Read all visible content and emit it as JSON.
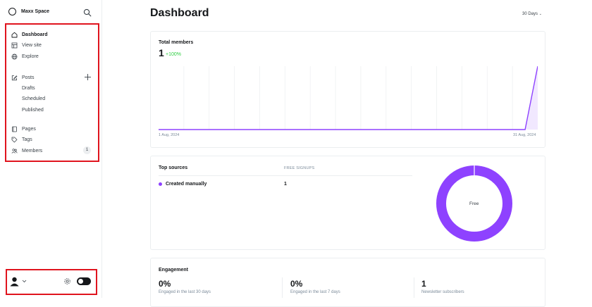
{
  "sidebar": {
    "brand": "Maxx Space",
    "nav_primary": [
      {
        "label": "Dashboard",
        "icon": "home-icon",
        "active": true
      },
      {
        "label": "View site",
        "icon": "layout-icon"
      },
      {
        "label": "Explore",
        "icon": "globe-icon"
      }
    ],
    "posts": {
      "label": "Posts",
      "icon": "pencil-square-icon",
      "sub": [
        "Drafts",
        "Scheduled",
        "Published"
      ]
    },
    "nav_secondary": [
      {
        "label": "Pages",
        "icon": "page-icon"
      },
      {
        "label": "Tags",
        "icon": "tag-icon"
      },
      {
        "label": "Members",
        "icon": "users-icon",
        "count": "1"
      }
    ]
  },
  "header": {
    "title": "Dashboard",
    "range": "30 Days"
  },
  "members_card": {
    "title": "Total members",
    "value": "1",
    "change": "+100%",
    "x_start": "1 Aug, 2024",
    "x_end": "31 Aug, 2024"
  },
  "chart_data": {
    "type": "line",
    "x": [
      "1 Aug, 2024",
      "31 Aug, 2024"
    ],
    "series": [
      {
        "values": [
          0,
          0,
          0,
          0,
          0,
          0,
          0,
          0,
          0,
          0,
          0,
          0,
          0,
          0,
          0,
          0,
          0,
          0,
          0,
          0,
          0,
          0,
          0,
          0,
          0,
          0,
          0,
          0,
          0,
          0,
          1
        ]
      }
    ],
    "color": "#8e42ff",
    "ylim": [
      0,
      1
    ],
    "grid": true
  },
  "sources_card": {
    "title": "Top sources",
    "col_header": "FREE SIGNUPS",
    "rows": [
      {
        "label": "Created manually",
        "value": "1"
      }
    ],
    "donut_label": "Free",
    "donut_color": "#8e42ff"
  },
  "engagement_card": {
    "title": "Engagement",
    "stats": [
      {
        "value": "0%",
        "caption": "Engaged in the last 30 days"
      },
      {
        "value": "0%",
        "caption": "Engaged in the last 7 days"
      },
      {
        "value": "1",
        "caption": "Newsletter subscribers"
      }
    ]
  },
  "colors": {
    "accent": "#8e42ff",
    "positive": "#30cf43",
    "highlight": "#e0141e"
  }
}
